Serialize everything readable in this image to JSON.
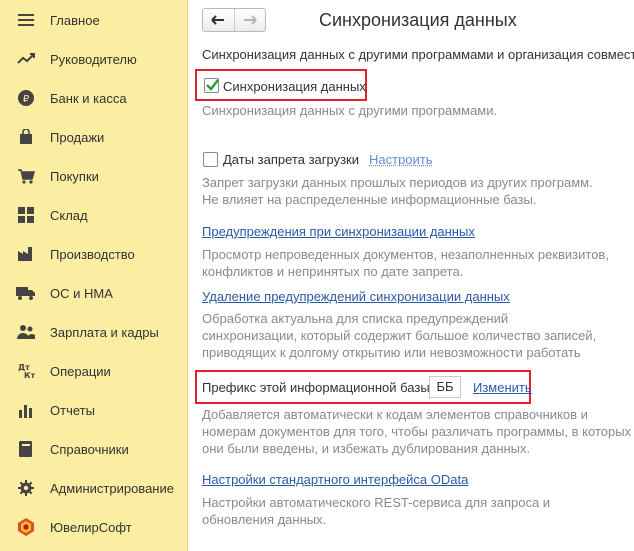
{
  "sidebar": {
    "items": [
      {
        "label": "Главное",
        "icon": "hamburger-icon"
      },
      {
        "label": "Руководителю",
        "icon": "trend-line-icon"
      },
      {
        "label": "Банк и касса",
        "icon": "ruble-coin-icon"
      },
      {
        "label": "Продажи",
        "icon": "shopping-bag-icon"
      },
      {
        "label": "Покупки",
        "icon": "shopping-cart-icon"
      },
      {
        "label": "Склад",
        "icon": "warehouse-grid-icon"
      },
      {
        "label": "Производство",
        "icon": "factory-icon"
      },
      {
        "label": "ОС и НМА",
        "icon": "truck-icon"
      },
      {
        "label": "Зарплата и кадры",
        "icon": "people-icon"
      },
      {
        "label": "Операции",
        "icon": "debit-credit-icon",
        "icon_text": "Дт Кт"
      },
      {
        "label": "Отчеты",
        "icon": "bar-chart-icon"
      },
      {
        "label": "Справочники",
        "icon": "book-icon"
      },
      {
        "label": "Администрирование",
        "icon": "gear-icon"
      },
      {
        "label": "ЮвелирСофт",
        "icon": "brand-logo-icon"
      }
    ]
  },
  "toolbar": {
    "back": "back-arrow-icon",
    "forward": "forward-arrow-icon",
    "title": "Синхронизация данных"
  },
  "main": {
    "intro": "Синхронизация данных с другими программами и организация совмест",
    "sync": {
      "label": "Синхронизация данных",
      "checked": true,
      "desc": "Синхронизация данных с другими программами."
    },
    "lock_dates": {
      "label": "Даты запрета загрузки",
      "checked": false,
      "link": "Настроить",
      "desc1": "Запрет загрузки данных прошлых периодов из других программ.",
      "desc2": "Не влияет на распределенные информационные базы."
    },
    "warnings": {
      "link": "Предупреждения при синхронизации данных",
      "desc1": "Просмотр непроведенных документов, незаполненных реквизитов,",
      "desc2": "конфликтов и непринятых по дате запрета."
    },
    "delete_warnings": {
      "link": "Удаление предупреждений синхронизации данных",
      "desc1": "Обработка актуальна для списка предупреждений",
      "desc2": "синхронизации, который содержит большое количество записей,",
      "desc3": "приводящих к долгому открытию или невозможности работать"
    },
    "prefix": {
      "label": "Префикс этой информационной базы:",
      "value": "ББ",
      "link": "Изменить",
      "desc1": "Добавляется автоматически к кодам элементов справочников и",
      "desc2": "номерам документов для того, чтобы различать программы, в которых",
      "desc3": "они были введены, и избежать дублирования данных."
    },
    "odata": {
      "link": "Настройки стандартного интерфейса OData",
      "desc1": "Настройки автоматического REST-сервиса для запроса и",
      "desc2": "обновления данных."
    }
  },
  "colors": {
    "sidebar_bg": "#fbeda1",
    "highlight": "#e2232a",
    "check": "#2e9b3c",
    "link": "#2b5aa5"
  }
}
